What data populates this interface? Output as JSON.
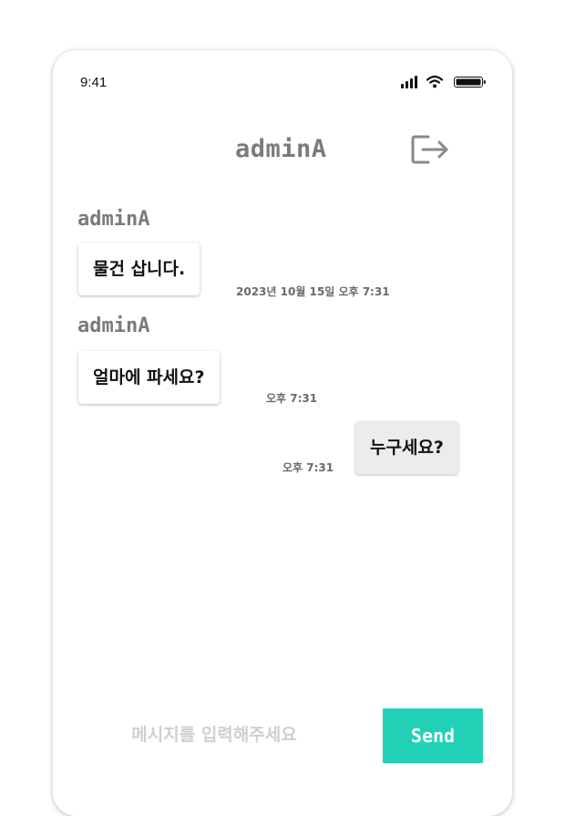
{
  "status_bar": {
    "time": "9:41",
    "icons": [
      "signal-icon",
      "wifi-icon",
      "battery-icon"
    ]
  },
  "header": {
    "title": "adminA",
    "logout_icon": "logout-icon"
  },
  "messages": [
    {
      "sender": "adminA",
      "text": "물건 삽니다.",
      "time": "2023년 10월 15일 오후 7:31",
      "direction": "received"
    },
    {
      "sender": "adminA",
      "text": "얼마에 파세요?",
      "time": "오후 7:31",
      "direction": "received"
    },
    {
      "sender": "",
      "text": "누구세요?",
      "time": "오후 7:31",
      "direction": "sent"
    }
  ],
  "composer": {
    "placeholder": "메시지를 입력해주세요",
    "value": "",
    "send_label": "Send"
  },
  "colors": {
    "accent": "#22d1b5",
    "sent_bubble": "#ececec",
    "received_bubble": "#ffffff",
    "name_text": "#7b7b7b",
    "timestamp_text": "#6a6a6a"
  }
}
